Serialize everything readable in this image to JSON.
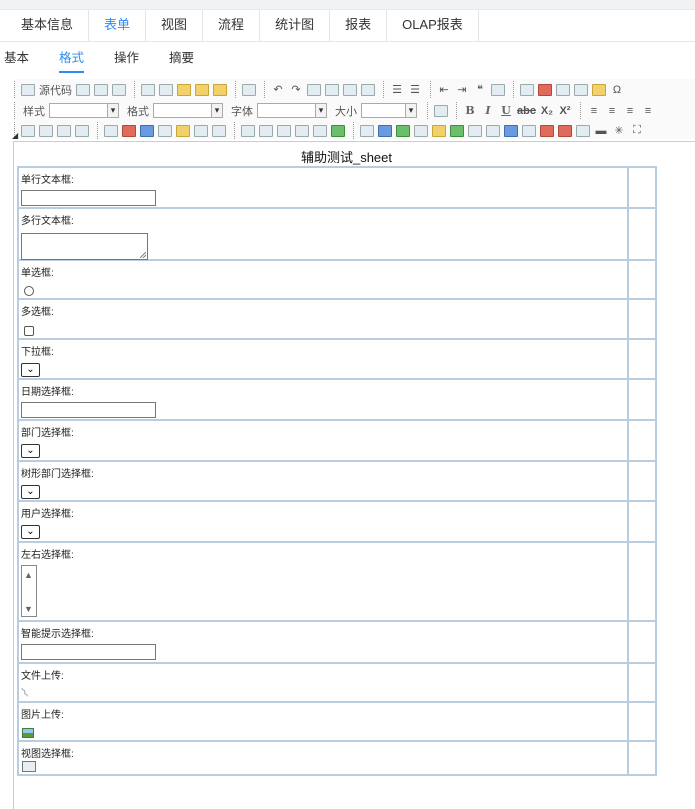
{
  "tabs": [
    "基本信息",
    "表单",
    "视图",
    "流程",
    "统计图",
    "报表",
    "OLAP报表"
  ],
  "subtabs": [
    "基本",
    "格式",
    "操作",
    "摘要"
  ],
  "toolbar": {
    "source_label": "源代码",
    "style_label": "样式",
    "format_label": "格式",
    "font_label": "字体",
    "size_label": "大小",
    "bold": "B",
    "italic": "I",
    "underline": "U",
    "strike": "abc",
    "subscript": "X₂",
    "superscript": "X²",
    "special_char": "Ω"
  },
  "sheet": {
    "title": "辅助测试_sheet",
    "fields": [
      {
        "label": "单行文本框:",
        "type": "text"
      },
      {
        "label": " 多行文本框:",
        "type": "textarea"
      },
      {
        "label": "单选框:",
        "type": "radio"
      },
      {
        "label": "多选框:",
        "type": "checkbox"
      },
      {
        "label": "下拉框:",
        "type": "select"
      },
      {
        "label": "日期选择框:",
        "type": "text"
      },
      {
        "label": "部门选择框:",
        "type": "select"
      },
      {
        "label": "树形部门选择框:",
        "type": "select"
      },
      {
        "label": "用户选择框:",
        "type": "select"
      },
      {
        "label": "左右选择框:",
        "type": "listbox"
      },
      {
        "label": "智能提示选择框:",
        "type": "text"
      },
      {
        "label": "文件上传:",
        "type": "file"
      },
      {
        "label": "图片上传:",
        "type": "image"
      },
      {
        "label": "视图选择框:",
        "type": "view"
      }
    ]
  }
}
